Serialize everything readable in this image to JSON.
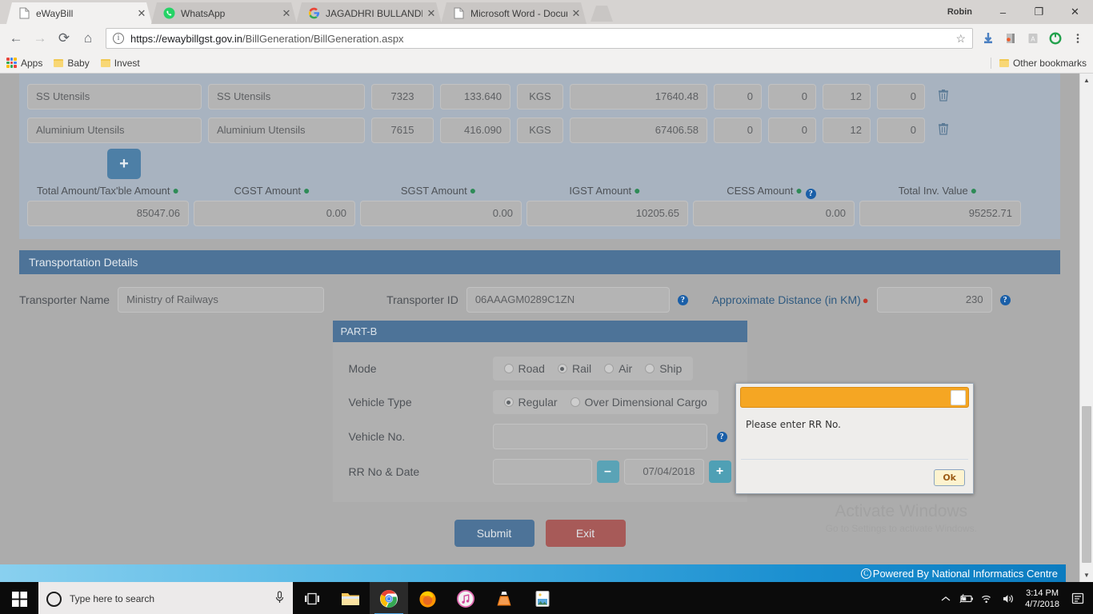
{
  "browser": {
    "tabs": [
      {
        "title": "eWayBill",
        "favicon": "page-icon",
        "active": true
      },
      {
        "title": "WhatsApp",
        "favicon": "whatsapp-icon",
        "active": false
      },
      {
        "title": "JAGADHRI BULLANDHSA",
        "favicon": "google-icon",
        "active": false
      },
      {
        "title": "Microsoft Word - Docum",
        "favicon": "page-icon",
        "active": false
      }
    ],
    "profile_name": "Robin",
    "window_controls": {
      "minimize": "–",
      "maximize": "❐",
      "close": "✕"
    },
    "url_secure_part": "https://ewaybillgst.gov.in",
    "url_path_part": "/BillGeneration/BillGeneration.aspx",
    "bookmarks": [
      {
        "label": "Apps",
        "icon": "apps-grid-icon"
      },
      {
        "label": "Baby",
        "icon": "folder-icon"
      },
      {
        "label": "Invest",
        "icon": "folder-icon"
      }
    ],
    "other_bookmarks_label": "Other bookmarks"
  },
  "items": {
    "rows": [
      {
        "product_name": "SS Utensils",
        "description": "SS Utensils",
        "hsn": "7323",
        "quantity": "133.640",
        "unit": "KGS",
        "taxable_value": "17640.48",
        "cgst_rate": "0",
        "sgst_rate": "0",
        "igst_rate": "12",
        "cess_rate": "0"
      },
      {
        "product_name": "Aluminium Utensils",
        "description": "Aluminium Utensils",
        "hsn": "7615",
        "quantity": "416.090",
        "unit": "KGS",
        "taxable_value": "67406.58",
        "cgst_rate": "0",
        "sgst_rate": "0",
        "igst_rate": "12",
        "cess_rate": "0"
      }
    ],
    "add_button_label": "+",
    "delete_icon": "trash-icon"
  },
  "totals": {
    "labels": {
      "total_amount": "Total Amount/Tax'ble Amount",
      "cgst": "CGST Amount",
      "sgst": "SGST Amount",
      "igst": "IGST Amount",
      "cess": "CESS Amount",
      "total_inv": "Total Inv. Value"
    },
    "values": {
      "total_amount": "85047.06",
      "cgst": "0.00",
      "sgst": "0.00",
      "igst": "10205.65",
      "cess": "0.00",
      "total_inv": "95252.71"
    }
  },
  "transportation": {
    "section_title": "Transportation Details",
    "transporter_name_label": "Transporter Name",
    "transporter_name_value": "Ministry of Railways",
    "transporter_id_label": "Transporter ID",
    "transporter_id_value": "06AAAGM0289C1ZN",
    "distance_label": "Approximate Distance (in KM)",
    "distance_value": "230"
  },
  "part_b": {
    "title": "PART-B",
    "mode_label": "Mode",
    "mode_options": [
      {
        "label": "Road",
        "selected": false
      },
      {
        "label": "Rail",
        "selected": true
      },
      {
        "label": "Air",
        "selected": false
      },
      {
        "label": "Ship",
        "selected": false
      }
    ],
    "vehicle_type_label": "Vehicle Type",
    "vehicle_type_options": [
      {
        "label": "Regular",
        "selected": true
      },
      {
        "label": "Over Dimensional Cargo",
        "selected": false
      }
    ],
    "vehicle_no_label": "Vehicle No.",
    "vehicle_no_value": "",
    "rr_label": "RR No & Date",
    "rr_no_value": "",
    "rr_date_value": "07/04/2018",
    "minus_label": "–",
    "plus_label": "+"
  },
  "actions": {
    "submit_label": "Submit",
    "exit_label": "Exit"
  },
  "dialog": {
    "title": "",
    "message": "Please enter RR No.",
    "ok_label": "Ok",
    "close_icon": "close-icon",
    "title_bar_color": "#f5a623"
  },
  "watermark": {
    "line1": "Activate Windows",
    "line2": "Go to Settings to activate Windows."
  },
  "footer": {
    "text": "Powered By National Informatics Centre",
    "copyright_symbol": "C"
  },
  "taskbar": {
    "search_placeholder": "Type here to search",
    "clock_time": "3:14 PM",
    "clock_date": "4/7/2018",
    "apps": [
      {
        "name": "task-view-icon"
      },
      {
        "name": "file-explorer-icon"
      },
      {
        "name": "chrome-icon"
      },
      {
        "name": "firefox-icon"
      },
      {
        "name": "itunes-icon"
      },
      {
        "name": "vlc-icon"
      },
      {
        "name": "photos-icon"
      }
    ]
  }
}
